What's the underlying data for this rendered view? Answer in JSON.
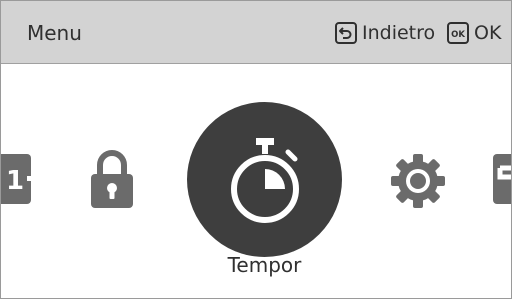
{
  "header": {
    "title": "Menu",
    "back_label": "Indietro",
    "ok_label": "OK",
    "back_icon": "return-arrow-icon",
    "ok_icon": "ok-key-icon"
  },
  "carousel": {
    "selected_label": "Tempor",
    "items": [
      {
        "icon": "partial-tile-left-icon",
        "glyph": "1"
      },
      {
        "icon": "lock-icon"
      },
      {
        "icon": "stopwatch-icon",
        "selected": true
      },
      {
        "icon": "gear-icon"
      },
      {
        "icon": "partial-tile-right-icon"
      }
    ]
  },
  "colors": {
    "header_bg": "#d3d3d3",
    "icon_gray": "#6b6b6b",
    "selected_circle": "#3e3e3e",
    "text": "#303030"
  }
}
